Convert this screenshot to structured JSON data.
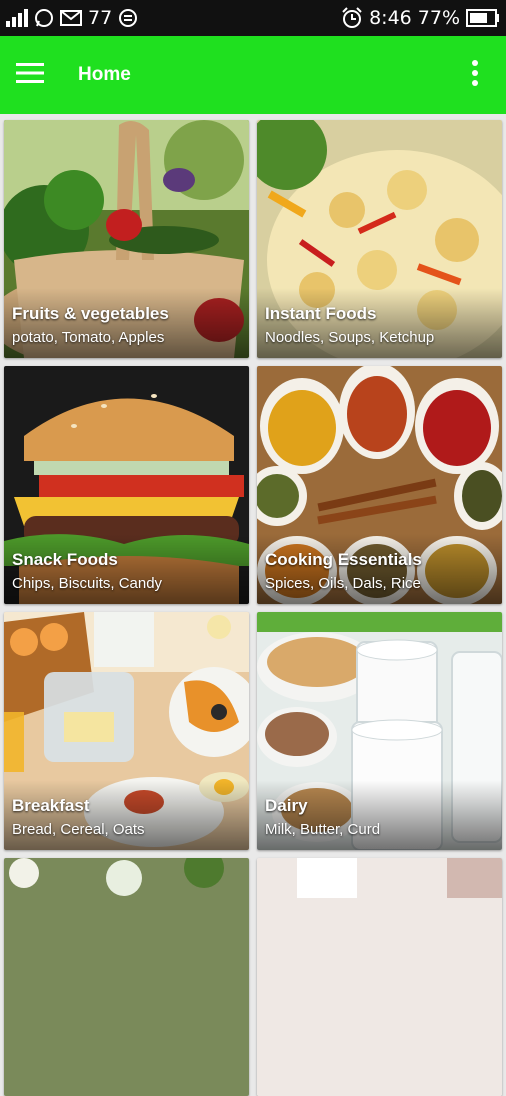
{
  "status_bar": {
    "network": "77",
    "time": "8:46",
    "battery": "77%"
  },
  "app_bar": {
    "title": "Home",
    "color": "#1fe01f"
  },
  "categories": [
    {
      "title": "Fruits & vegetables",
      "subtitle": "potato, Tomato, Apples"
    },
    {
      "title": "Instant Foods",
      "subtitle": "Noodles, Soups, Ketchup"
    },
    {
      "title": "Snack Foods",
      "subtitle": "Chips, Biscuits, Candy"
    },
    {
      "title": "Cooking Essentials",
      "subtitle": "Spices, Oils, Dals, Rice"
    },
    {
      "title": "Breakfast",
      "subtitle": "Bread, Cereal, Oats"
    },
    {
      "title": "Dairy",
      "subtitle": "Milk, Butter, Curd"
    }
  ]
}
